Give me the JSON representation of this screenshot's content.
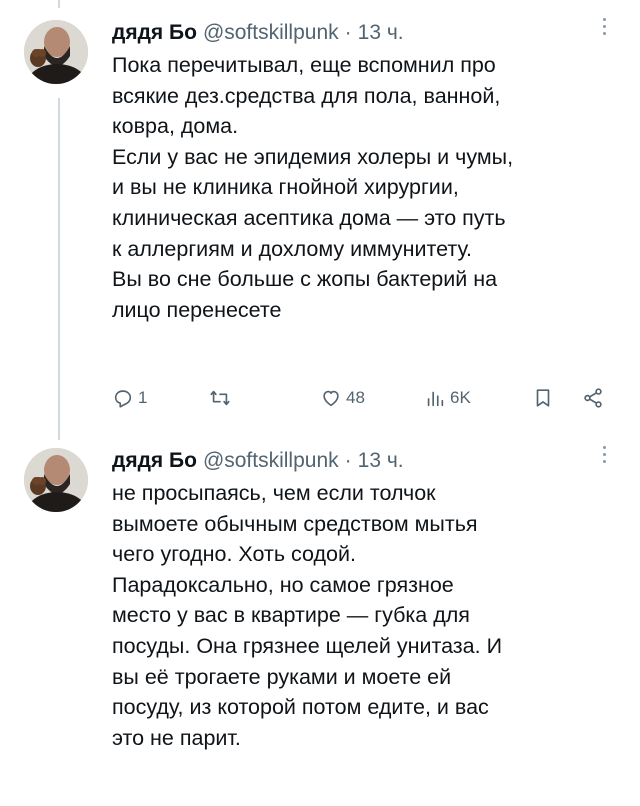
{
  "tweets": [
    {
      "author": {
        "name": "дядя Бо",
        "handle": "@softskillpunk",
        "separator": "·",
        "time": "13 ч."
      },
      "lines": [
        "Пока перечитывал, еще вспомнил про",
        "всякие дез.средства для пола, ванной,",
        "ковра, дома.",
        "Если у вас не эпидемия холеры и чумы,",
        "и вы не клиника гнойной хирургии,",
        "клиническая асептика дома — это путь",
        "к аллергиям и дохлому иммунитету.",
        "Вы во сне больше с жопы бактерий на",
        "лицо перенесете"
      ],
      "actions": {
        "reply": {
          "icon": "reply-icon",
          "count": "1"
        },
        "retweet": {
          "icon": "retweet-icon",
          "count": ""
        },
        "like": {
          "icon": "heart-icon",
          "count": "48"
        },
        "views": {
          "icon": "views-icon",
          "count": "6K"
        },
        "bookmark": {
          "icon": "bookmark-icon"
        },
        "share": {
          "icon": "share-icon"
        }
      }
    },
    {
      "author": {
        "name": "дядя Бо",
        "handle": "@softskillpunk",
        "separator": "·",
        "time": "13 ч."
      },
      "lines": [
        "не просыпаясь, чем если толчок",
        "вымоете обычным средством мытья",
        "чего угодно. Хоть содой.",
        "Парадоксально, но самое грязное",
        "место у вас в квартире — губка для",
        "посуды. Она грязнее щелей унитаза. И",
        "вы её трогаете руками и  моете ей",
        "посуду, из которой потом едите, и вас",
        "это не парит."
      ]
    }
  ],
  "colors": {
    "text": "#0f1419",
    "secondary": "#536471",
    "thread_line": "#cfd9de"
  }
}
